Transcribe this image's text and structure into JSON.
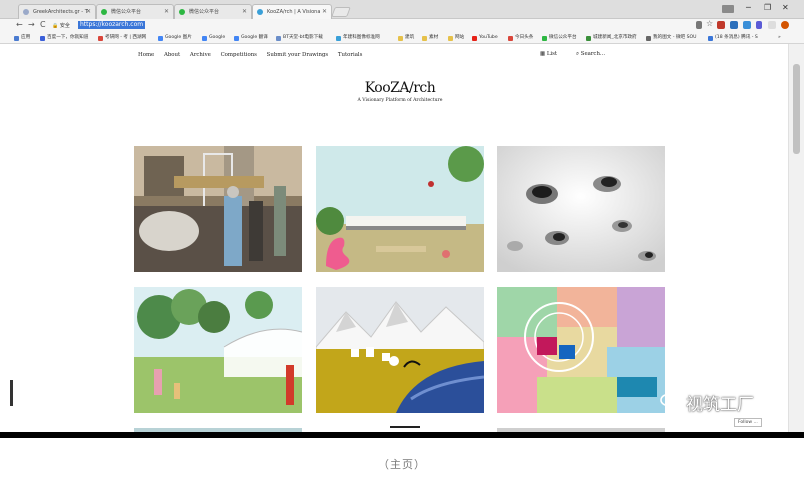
{
  "browser": {
    "tabs": [
      {
        "label": "GreekArchitects.gr - T",
        "favicon_color": "#9aa9c9",
        "active": false
      },
      {
        "label": "微信公众平台",
        "favicon_color": "#2db742",
        "active": false
      },
      {
        "label": "微信公众平台",
        "favicon_color": "#2db742",
        "active": false
      },
      {
        "label": "KooZA/rch | A Visiona",
        "favicon_color": "#3aa0d8",
        "active": true
      }
    ],
    "window_controls": {
      "minimize": "─",
      "maximize": "❐",
      "close": "✕"
    },
    "nav": {
      "back": "←",
      "forward": "→",
      "reload": "C"
    },
    "security_label": "安全",
    "url": "https://koozarch.com",
    "bookmarks": [
      {
        "label": "应用",
        "color": "#4a7bd0"
      },
      {
        "label": "百度一下，你就知道",
        "color": "#3b5fd9"
      },
      {
        "label": "考研网 - 考 | 西湖网",
        "color": "#d9463b"
      },
      {
        "label": "Google 图片",
        "color": "#4285f4"
      },
      {
        "label": "Google",
        "color": "#4285f4"
      },
      {
        "label": "Google 翻译",
        "color": "#4285f4"
      },
      {
        "label": "BT天堂-bt电影下载",
        "color": "#6b8ec9"
      },
      {
        "label": "年建科图像标准网",
        "color": "#3aa0d8"
      },
      {
        "label": "建筑",
        "color": "#e6c14a"
      },
      {
        "label": "素材",
        "color": "#e6c14a"
      },
      {
        "label": "网站",
        "color": "#e6c14a"
      },
      {
        "label": "YouTube",
        "color": "#e62117"
      },
      {
        "label": "今日头条",
        "color": "#d9463b"
      },
      {
        "label": "微信公众平台",
        "color": "#2db742"
      },
      {
        "label": "城建新闻_北京市政府",
        "color": "#3a8f3a"
      },
      {
        "label": "我的图文 - 微吧 SOU",
        "color": "#666666"
      },
      {
        "label": "(18 条消息) 腾讯 - S",
        "color": "#3a76d8"
      }
    ]
  },
  "site": {
    "nav": [
      "Home",
      "About",
      "Archive",
      "Competitions",
      "Submit your Drawings",
      "Tutorials"
    ],
    "list_label": "List",
    "search_label": "Search...",
    "logo": "KooZA/rch",
    "tagline": "A Visionary Platform of Architecture"
  },
  "watermark": "视筑工厂",
  "tray_popup": "Follow ...",
  "caption": "（主页）",
  "colors": {
    "url_highlight": "#3a76d8",
    "tab_strip": "#dedede"
  }
}
